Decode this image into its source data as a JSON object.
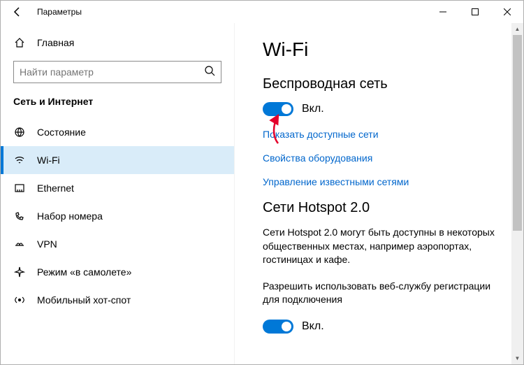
{
  "window": {
    "title": "Параметры"
  },
  "sidebar": {
    "home_label": "Главная",
    "search_placeholder": "Найти параметр",
    "section": "Сеть и Интернет",
    "items": [
      {
        "label": "Состояние"
      },
      {
        "label": "Wi-Fi"
      },
      {
        "label": "Ethernet"
      },
      {
        "label": "Набор номера"
      },
      {
        "label": "VPN"
      },
      {
        "label": "Режим «в самолете»"
      },
      {
        "label": "Мобильный хот-спот"
      }
    ]
  },
  "main": {
    "heading": "Wi-Fi",
    "section1": {
      "title": "Беспроводная сеть",
      "toggle_label": "Вкл.",
      "links": [
        "Показать доступные сети",
        "Свойства оборудования",
        "Управление известными сетями"
      ]
    },
    "section2": {
      "title": "Сети Hotspot 2.0",
      "description": "Сети Hotspot 2.0 могут быть доступны в некоторых общественных местах, например аэропортах, гостиницах и кафе.",
      "description2": "Разрешить использовать веб-службу регистрации для подключения",
      "toggle_label": "Вкл."
    }
  }
}
